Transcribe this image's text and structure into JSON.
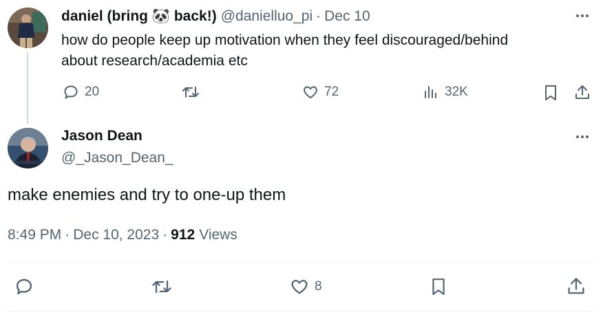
{
  "parent_tweet": {
    "display_name_pre": "daniel (bring",
    "display_name_emoji": "🐼",
    "display_name_post": "back!)",
    "handle": "@danielluo_pi",
    "separator": "·",
    "date": "Dec 10",
    "text_line1": "how do people keep up motivation when they feel discouraged/behind",
    "text_line2": "about research/academia etc",
    "actions": {
      "reply_count": "20",
      "retweet_count": "",
      "like_count": "72",
      "views_count": "32K"
    }
  },
  "main_tweet": {
    "display_name": "Jason Dean",
    "handle": "@_Jason_Dean_",
    "text": "make enemies and try to one-up them",
    "time": "8:49 PM",
    "sep1": "·",
    "date": "Dec 10, 2023",
    "sep2": "·",
    "views_count": "912",
    "views_label": "Views",
    "actions": {
      "like_count": "8"
    }
  },
  "colors": {
    "text": "#0f1419",
    "muted": "#536471",
    "divider": "#eff3f4",
    "thread_line": "#cfd9de"
  }
}
